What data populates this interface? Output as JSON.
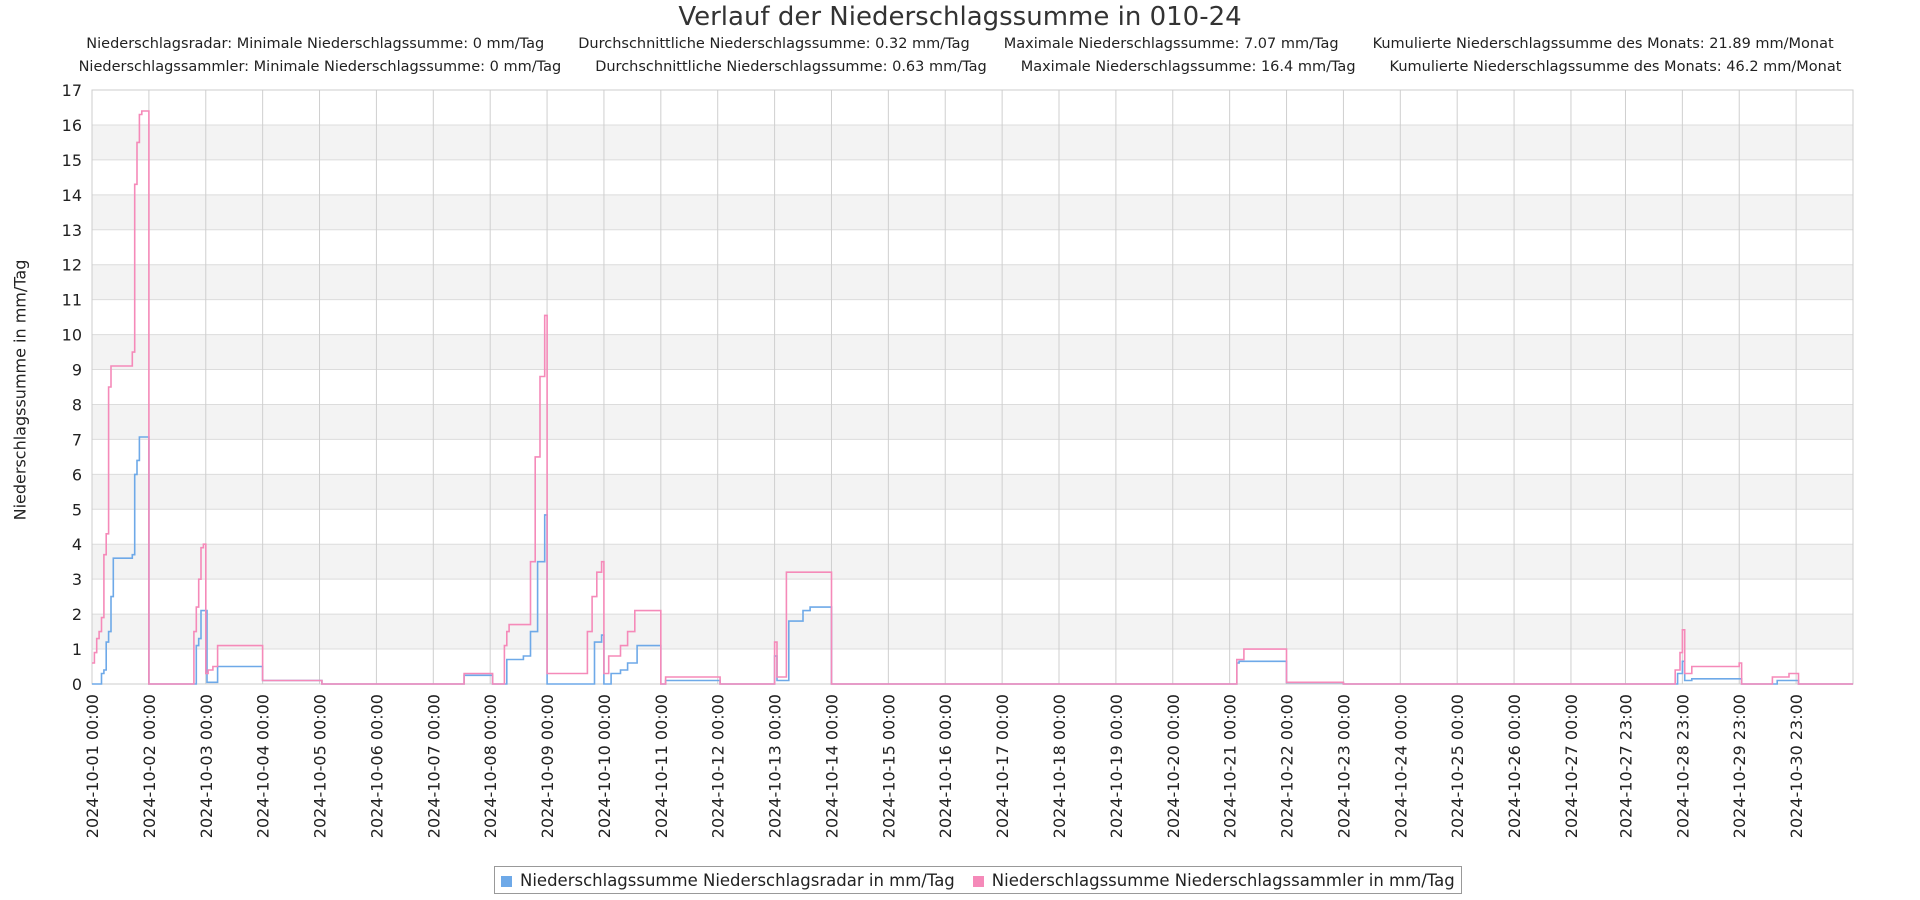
{
  "chart_data": {
    "type": "line",
    "title": "Verlauf der Niederschlagssumme in 010-24",
    "ylabel": "Niederschlagssumme in mm/Tag",
    "xlabel": "",
    "ylim": [
      0,
      17
    ],
    "yticks": [
      0,
      1,
      2,
      3,
      4,
      5,
      6,
      7,
      8,
      9,
      10,
      11,
      12,
      13,
      14,
      15,
      16,
      17
    ],
    "grid": true,
    "legend_position": "bottom-center",
    "xlim": [
      "2024-10-01 00:00",
      "2024-10-31 23:00"
    ],
    "xtick_labels": [
      "2024-10-01 00:00",
      "2024-10-02 00:00",
      "2024-10-03 00:00",
      "2024-10-04 00:00",
      "2024-10-05 00:00",
      "2024-10-06 00:00",
      "2024-10-07 00:00",
      "2024-10-08 00:00",
      "2024-10-09 00:00",
      "2024-10-10 00:00",
      "2024-10-11 00:00",
      "2024-10-12 00:00",
      "2024-10-13 00:00",
      "2024-10-14 00:00",
      "2024-10-15 00:00",
      "2024-10-16 00:00",
      "2024-10-17 00:00",
      "2024-10-18 00:00",
      "2024-10-19 00:00",
      "2024-10-20 00:00",
      "2024-10-21 00:00",
      "2024-10-22 00:00",
      "2024-10-23 00:00",
      "2024-10-24 00:00",
      "2024-10-25 00:00",
      "2024-10-26 00:00",
      "2024-10-27 00:00",
      "2024-10-27 23:00",
      "2024-10-28 23:00",
      "2024-10-29 23:00",
      "2024-10-30 23:00"
    ],
    "series": [
      {
        "name": "Niederschlagssumme Niederschlagsradar in mm/Tag",
        "color": "#6ea9e8",
        "points": [
          [
            "2024-10-01 00:00",
            0
          ],
          [
            "2024-10-01 02:00",
            0
          ],
          [
            "2024-10-01 04:00",
            0.3
          ],
          [
            "2024-10-01 05:00",
            0.4
          ],
          [
            "2024-10-01 06:00",
            1.2
          ],
          [
            "2024-10-01 07:00",
            1.5
          ],
          [
            "2024-10-01 08:00",
            2.5
          ],
          [
            "2024-10-01 09:00",
            3.6
          ],
          [
            "2024-10-01 15:00",
            3.6
          ],
          [
            "2024-10-01 17:00",
            3.7
          ],
          [
            "2024-10-01 18:00",
            6.0
          ],
          [
            "2024-10-01 19:00",
            6.4
          ],
          [
            "2024-10-01 20:00",
            7.07
          ],
          [
            "2024-10-01 23:00",
            7.07
          ],
          [
            "2024-10-02 00:00",
            0
          ],
          [
            "2024-10-02 19:00",
            0
          ],
          [
            "2024-10-02 20:00",
            1.1
          ],
          [
            "2024-10-02 21:00",
            1.3
          ],
          [
            "2024-10-02 22:00",
            2.1
          ],
          [
            "2024-10-03 00:00",
            2.1
          ],
          [
            "2024-10-03 00:30",
            0.05
          ],
          [
            "2024-10-03 04:00",
            0.05
          ],
          [
            "2024-10-03 05:00",
            0.5
          ],
          [
            "2024-10-03 23:00",
            0.5
          ],
          [
            "2024-10-04 00:00",
            0.1
          ],
          [
            "2024-10-05 00:00",
            0.1
          ],
          [
            "2024-10-05 01:00",
            0
          ],
          [
            "2024-10-07 12:00",
            0
          ],
          [
            "2024-10-07 13:00",
            0.25
          ],
          [
            "2024-10-08 00:00",
            0.25
          ],
          [
            "2024-10-08 01:00",
            0
          ],
          [
            "2024-10-08 06:00",
            0
          ],
          [
            "2024-10-08 07:00",
            0.7
          ],
          [
            "2024-10-08 14:00",
            0.8
          ],
          [
            "2024-10-08 17:00",
            1.5
          ],
          [
            "2024-10-08 20:00",
            3.5
          ],
          [
            "2024-10-08 23:00",
            4.84
          ],
          [
            "2024-10-09 00:00",
            0
          ],
          [
            "2024-10-09 18:00",
            0
          ],
          [
            "2024-10-09 20:00",
            1.2
          ],
          [
            "2024-10-09 23:00",
            1.4
          ],
          [
            "2024-10-10 00:00",
            0
          ],
          [
            "2024-10-10 03:00",
            0.3
          ],
          [
            "2024-10-10 07:00",
            0.4
          ],
          [
            "2024-10-10 10:00",
            0.6
          ],
          [
            "2024-10-10 14:00",
            1.1
          ],
          [
            "2024-10-10 23:00",
            1.1
          ],
          [
            "2024-10-11 00:00",
            0
          ],
          [
            "2024-10-11 02:00",
            0.1
          ],
          [
            "2024-10-12 00:00",
            0.1
          ],
          [
            "2024-10-12 01:00",
            0
          ],
          [
            "2024-10-12 23:00",
            0
          ],
          [
            "2024-10-13 00:00",
            0.8
          ],
          [
            "2024-10-13 01:00",
            0.1
          ],
          [
            "2024-10-13 05:00",
            0.1
          ],
          [
            "2024-10-13 06:00",
            1.8
          ],
          [
            "2024-10-13 09:00",
            1.8
          ],
          [
            "2024-10-13 12:00",
            2.1
          ],
          [
            "2024-10-13 15:00",
            2.2
          ],
          [
            "2024-10-13 23:00",
            2.2
          ],
          [
            "2024-10-14 00:00",
            0
          ],
          [
            "2024-10-21 00:00",
            0
          ],
          [
            "2024-10-21 03:00",
            0.6
          ],
          [
            "2024-10-21 04:00",
            0.65
          ],
          [
            "2024-10-21 23:00",
            0.65
          ],
          [
            "2024-10-22 00:00",
            0.04
          ],
          [
            "2024-10-22 23:00",
            0.04
          ],
          [
            "2024-10-23 00:00",
            0
          ],
          [
            "2024-10-28 18:00",
            0
          ],
          [
            "2024-10-28 21:00",
            0.3
          ],
          [
            "2024-10-28 23:00",
            0.65
          ],
          [
            "2024-10-29 00:00",
            0.1
          ],
          [
            "2024-10-29 03:00",
            0.15
          ],
          [
            "2024-10-29 23:00",
            0.15
          ],
          [
            "2024-10-30 00:00",
            0
          ],
          [
            "2024-10-30 14:00",
            0
          ],
          [
            "2024-10-30 15:00",
            0.1
          ],
          [
            "2024-10-30 23:00",
            0.1
          ],
          [
            "2024-10-31 00:00",
            0
          ],
          [
            "2024-10-31 23:00",
            0
          ]
        ]
      },
      {
        "name": "Niederschlagssumme Niederschlagssammler in mm/Tag",
        "color": "#f58ab9",
        "points": [
          [
            "2024-10-01 00:00",
            0.6
          ],
          [
            "2024-10-01 01:00",
            0.9
          ],
          [
            "2024-10-01 02:00",
            1.3
          ],
          [
            "2024-10-01 03:00",
            1.5
          ],
          [
            "2024-10-01 04:00",
            1.9
          ],
          [
            "2024-10-01 05:00",
            3.7
          ],
          [
            "2024-10-01 06:00",
            4.3
          ],
          [
            "2024-10-01 07:00",
            8.5
          ],
          [
            "2024-10-01 08:00",
            9.1
          ],
          [
            "2024-10-01 15:00",
            9.1
          ],
          [
            "2024-10-01 17:00",
            9.5
          ],
          [
            "2024-10-01 18:00",
            14.3
          ],
          [
            "2024-10-01 19:00",
            15.5
          ],
          [
            "2024-10-01 20:00",
            16.3
          ],
          [
            "2024-10-01 21:00",
            16.4
          ],
          [
            "2024-10-01 23:00",
            16.4
          ],
          [
            "2024-10-02 00:00",
            0
          ],
          [
            "2024-10-02 18:00",
            0
          ],
          [
            "2024-10-02 19:00",
            1.5
          ],
          [
            "2024-10-02 20:00",
            2.2
          ],
          [
            "2024-10-02 21:00",
            3.0
          ],
          [
            "2024-10-02 22:00",
            3.9
          ],
          [
            "2024-10-02 23:00",
            4.0
          ],
          [
            "2024-10-03 00:00",
            0.3
          ],
          [
            "2024-10-03 01:00",
            0.4
          ],
          [
            "2024-10-03 03:00",
            0.5
          ],
          [
            "2024-10-03 05:00",
            1.1
          ],
          [
            "2024-10-03 23:00",
            1.1
          ],
          [
            "2024-10-04 00:00",
            0.1
          ],
          [
            "2024-10-05 00:00",
            0.1
          ],
          [
            "2024-10-05 01:00",
            0
          ],
          [
            "2024-10-07 12:00",
            0
          ],
          [
            "2024-10-07 13:00",
            0.3
          ],
          [
            "2024-10-08 00:00",
            0.3
          ],
          [
            "2024-10-08 01:00",
            0
          ],
          [
            "2024-10-08 05:00",
            0
          ],
          [
            "2024-10-08 06:00",
            1.1
          ],
          [
            "2024-10-08 07:00",
            1.5
          ],
          [
            "2024-10-08 08:00",
            1.7
          ],
          [
            "2024-10-08 14:00",
            1.7
          ],
          [
            "2024-10-08 17:00",
            3.5
          ],
          [
            "2024-10-08 19:00",
            6.5
          ],
          [
            "2024-10-08 21:00",
            8.8
          ],
          [
            "2024-10-08 23:00",
            10.55
          ],
          [
            "2024-10-09 00:00",
            0.3
          ],
          [
            "2024-10-09 15:00",
            0.3
          ],
          [
            "2024-10-09 17:00",
            1.5
          ],
          [
            "2024-10-09 19:00",
            2.5
          ],
          [
            "2024-10-09 21:00",
            3.2
          ],
          [
            "2024-10-09 23:00",
            3.5
          ],
          [
            "2024-10-10 00:00",
            0.3
          ],
          [
            "2024-10-10 02:00",
            0.8
          ],
          [
            "2024-10-10 07:00",
            1.1
          ],
          [
            "2024-10-10 10:00",
            1.5
          ],
          [
            "2024-10-10 13:00",
            2.1
          ],
          [
            "2024-10-10 23:00",
            2.1
          ],
          [
            "2024-10-11 00:00",
            0
          ],
          [
            "2024-10-11 02:00",
            0.2
          ],
          [
            "2024-10-12 00:00",
            0.2
          ],
          [
            "2024-10-12 01:00",
            0
          ],
          [
            "2024-10-12 23:00",
            0
          ],
          [
            "2024-10-13 00:00",
            1.2
          ],
          [
            "2024-10-13 01:00",
            0.2
          ],
          [
            "2024-10-13 04:00",
            0.2
          ],
          [
            "2024-10-13 05:00",
            3.2
          ],
          [
            "2024-10-13 23:00",
            3.2
          ],
          [
            "2024-10-14 00:00",
            0
          ],
          [
            "2024-10-21 00:00",
            0
          ],
          [
            "2024-10-21 03:00",
            0.7
          ],
          [
            "2024-10-21 06:00",
            1.0
          ],
          [
            "2024-10-21 23:00",
            1.0
          ],
          [
            "2024-10-22 00:00",
            0.05
          ],
          [
            "2024-10-22 23:00",
            0.05
          ],
          [
            "2024-10-23 00:00",
            0
          ],
          [
            "2024-10-28 18:00",
            0
          ],
          [
            "2024-10-28 20:00",
            0.4
          ],
          [
            "2024-10-28 22:00",
            0.9
          ],
          [
            "2024-10-28 23:00",
            1.55
          ],
          [
            "2024-10-29 00:00",
            0.3
          ],
          [
            "2024-10-29 03:00",
            0.5
          ],
          [
            "2024-10-29 23:00",
            0.6
          ],
          [
            "2024-10-30 00:00",
            0
          ],
          [
            "2024-10-30 12:00",
            0
          ],
          [
            "2024-10-30 13:00",
            0.2
          ],
          [
            "2024-10-30 20:00",
            0.3
          ],
          [
            "2024-10-30 23:00",
            0.3
          ],
          [
            "2024-10-31 00:00",
            0
          ],
          [
            "2024-10-31 23:00",
            0
          ]
        ]
      }
    ]
  },
  "stats": {
    "radar_line": [
      "Niederschlagsradar: Minimale Niederschlagssumme: 0 mm/Tag",
      "Durchschnittliche Niederschlagssumme: 0.32 mm/Tag",
      "Maximale Niederschlagssumme: 7.07 mm/Tag",
      "Kumulierte Niederschlagssumme des Monats: 21.89 mm/Monat"
    ],
    "sammler_line": [
      "Niederschlagssammler: Minimale Niederschlagssumme: 0 mm/Tag",
      "Durchschnittliche Niederschlagssumme: 0.63 mm/Tag",
      "Maximale Niederschlagssumme: 16.4 mm/Tag",
      "Kumulierte Niederschlagssumme des Monats: 46.2 mm/Monat"
    ]
  },
  "legend": {
    "radar": "Niederschlagssumme Niederschlagsradar in mm/Tag",
    "sammler": "Niederschlagssumme Niederschlagssammler in mm/Tag"
  }
}
